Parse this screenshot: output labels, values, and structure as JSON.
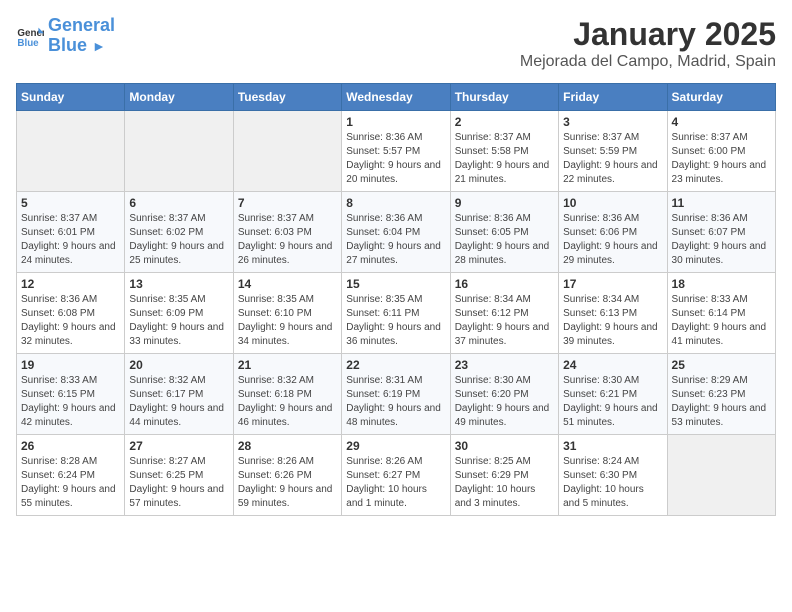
{
  "logo": {
    "line1": "General",
    "line2": "Blue"
  },
  "title": "January 2025",
  "subtitle": "Mejorada del Campo, Madrid, Spain",
  "days_of_week": [
    "Sunday",
    "Monday",
    "Tuesday",
    "Wednesday",
    "Thursday",
    "Friday",
    "Saturday"
  ],
  "weeks": [
    [
      {
        "day": "",
        "empty": true
      },
      {
        "day": "",
        "empty": true
      },
      {
        "day": "",
        "empty": true
      },
      {
        "day": "1",
        "sunrise": "8:36 AM",
        "sunset": "5:57 PM",
        "daylight": "9 hours and 20 minutes."
      },
      {
        "day": "2",
        "sunrise": "8:37 AM",
        "sunset": "5:58 PM",
        "daylight": "9 hours and 21 minutes."
      },
      {
        "day": "3",
        "sunrise": "8:37 AM",
        "sunset": "5:59 PM",
        "daylight": "9 hours and 22 minutes."
      },
      {
        "day": "4",
        "sunrise": "8:37 AM",
        "sunset": "6:00 PM",
        "daylight": "9 hours and 23 minutes."
      }
    ],
    [
      {
        "day": "5",
        "sunrise": "8:37 AM",
        "sunset": "6:01 PM",
        "daylight": "9 hours and 24 minutes."
      },
      {
        "day": "6",
        "sunrise": "8:37 AM",
        "sunset": "6:02 PM",
        "daylight": "9 hours and 25 minutes."
      },
      {
        "day": "7",
        "sunrise": "8:37 AM",
        "sunset": "6:03 PM",
        "daylight": "9 hours and 26 minutes."
      },
      {
        "day": "8",
        "sunrise": "8:36 AM",
        "sunset": "6:04 PM",
        "daylight": "9 hours and 27 minutes."
      },
      {
        "day": "9",
        "sunrise": "8:36 AM",
        "sunset": "6:05 PM",
        "daylight": "9 hours and 28 minutes."
      },
      {
        "day": "10",
        "sunrise": "8:36 AM",
        "sunset": "6:06 PM",
        "daylight": "9 hours and 29 minutes."
      },
      {
        "day": "11",
        "sunrise": "8:36 AM",
        "sunset": "6:07 PM",
        "daylight": "9 hours and 30 minutes."
      }
    ],
    [
      {
        "day": "12",
        "sunrise": "8:36 AM",
        "sunset": "6:08 PM",
        "daylight": "9 hours and 32 minutes."
      },
      {
        "day": "13",
        "sunrise": "8:35 AM",
        "sunset": "6:09 PM",
        "daylight": "9 hours and 33 minutes."
      },
      {
        "day": "14",
        "sunrise": "8:35 AM",
        "sunset": "6:10 PM",
        "daylight": "9 hours and 34 minutes."
      },
      {
        "day": "15",
        "sunrise": "8:35 AM",
        "sunset": "6:11 PM",
        "daylight": "9 hours and 36 minutes."
      },
      {
        "day": "16",
        "sunrise": "8:34 AM",
        "sunset": "6:12 PM",
        "daylight": "9 hours and 37 minutes."
      },
      {
        "day": "17",
        "sunrise": "8:34 AM",
        "sunset": "6:13 PM",
        "daylight": "9 hours and 39 minutes."
      },
      {
        "day": "18",
        "sunrise": "8:33 AM",
        "sunset": "6:14 PM",
        "daylight": "9 hours and 41 minutes."
      }
    ],
    [
      {
        "day": "19",
        "sunrise": "8:33 AM",
        "sunset": "6:15 PM",
        "daylight": "9 hours and 42 minutes."
      },
      {
        "day": "20",
        "sunrise": "8:32 AM",
        "sunset": "6:17 PM",
        "daylight": "9 hours and 44 minutes."
      },
      {
        "day": "21",
        "sunrise": "8:32 AM",
        "sunset": "6:18 PM",
        "daylight": "9 hours and 46 minutes."
      },
      {
        "day": "22",
        "sunrise": "8:31 AM",
        "sunset": "6:19 PM",
        "daylight": "9 hours and 48 minutes."
      },
      {
        "day": "23",
        "sunrise": "8:30 AM",
        "sunset": "6:20 PM",
        "daylight": "9 hours and 49 minutes."
      },
      {
        "day": "24",
        "sunrise": "8:30 AM",
        "sunset": "6:21 PM",
        "daylight": "9 hours and 51 minutes."
      },
      {
        "day": "25",
        "sunrise": "8:29 AM",
        "sunset": "6:23 PM",
        "daylight": "9 hours and 53 minutes."
      }
    ],
    [
      {
        "day": "26",
        "sunrise": "8:28 AM",
        "sunset": "6:24 PM",
        "daylight": "9 hours and 55 minutes."
      },
      {
        "day": "27",
        "sunrise": "8:27 AM",
        "sunset": "6:25 PM",
        "daylight": "9 hours and 57 minutes."
      },
      {
        "day": "28",
        "sunrise": "8:26 AM",
        "sunset": "6:26 PM",
        "daylight": "9 hours and 59 minutes."
      },
      {
        "day": "29",
        "sunrise": "8:26 AM",
        "sunset": "6:27 PM",
        "daylight": "10 hours and 1 minute."
      },
      {
        "day": "30",
        "sunrise": "8:25 AM",
        "sunset": "6:29 PM",
        "daylight": "10 hours and 3 minutes."
      },
      {
        "day": "31",
        "sunrise": "8:24 AM",
        "sunset": "6:30 PM",
        "daylight": "10 hours and 5 minutes."
      },
      {
        "day": "",
        "empty": true
      }
    ]
  ]
}
